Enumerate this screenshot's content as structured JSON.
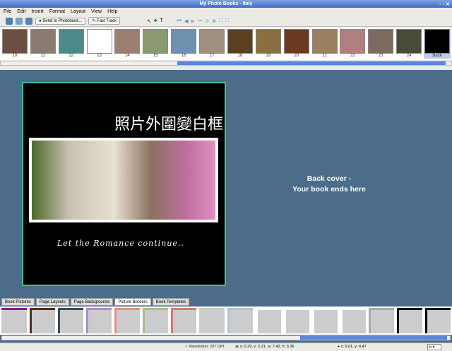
{
  "window": {
    "title": "My Photo Books  -  Italy"
  },
  "menu": [
    "File",
    "Edit",
    "Insert",
    "Format",
    "Layout",
    "View",
    "Help"
  ],
  "toolbar": {
    "send_label": "Send to Photobook...",
    "fasttrack_label": "Fast Track"
  },
  "thumbnails": [
    "10",
    "11",
    "12",
    "13",
    "14",
    "15",
    "16",
    "17",
    "18",
    "19",
    "20",
    "21",
    "22",
    "23",
    "24",
    "Back"
  ],
  "page": {
    "chinese_title": "照片外圍變白框",
    "caption": "Let the Romance continue..",
    "back_line1": "Back cover  -",
    "back_line2": "Your book ends here"
  },
  "tabs": [
    "Book Pictures",
    "Page Layouts",
    "Page Backgrounds",
    "Picture Borders",
    "Book Templates"
  ],
  "active_tab": "Picture Borders",
  "border_colors": [
    "#8a1a8a",
    "#5a2a20",
    "#3a4a5a",
    "#b08ad0",
    "#e89080",
    "#9fc090",
    "#d87878",
    "#cccccc",
    "#b0c4d8",
    "#ffffff",
    "#ffffff",
    "#ffffff",
    "#ffffff",
    "#aaaaaa",
    "#000000",
    "#000000"
  ],
  "status": {
    "resolution": "Resolution: 207 DPI",
    "geometry": "x: 0.29, y: 2.21, w: 7.42, h: 3.36",
    "cursor": "x: 5.61, y: 4.47",
    "unit": "in"
  }
}
